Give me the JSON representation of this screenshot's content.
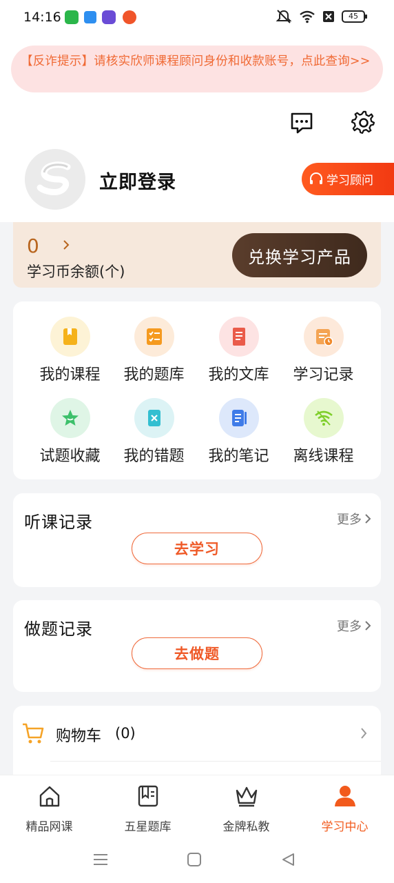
{
  "status_bar": {
    "time": "14:16",
    "battery": "45",
    "apps": [
      {
        "icon": "green-app-icon",
        "color": "#2bb64a"
      },
      {
        "icon": "blue-app-icon",
        "color": "#2e8ff0"
      },
      {
        "icon": "game-app-icon",
        "color": "#6a4cd6"
      },
      {
        "icon": "orange-app-icon",
        "color": "#f0552a"
      }
    ]
  },
  "notice": {
    "text": "【反诈提示】请核实欣师课程顾问身份和收款账号，点此查询>>"
  },
  "header_icons": {
    "message": "message-icon",
    "settings": "gear-icon"
  },
  "profile": {
    "login_label": "立即登录",
    "advisor_label": "学习顾问"
  },
  "coins": {
    "value": "0",
    "label": "学习币余额(个)",
    "exchange_label": "兑换学习产品"
  },
  "grid": {
    "items": [
      {
        "label": "我的课程",
        "icon": "course-book-icon",
        "bg": "#fdf3d6",
        "fg": "#f5b21b"
      },
      {
        "label": "我的题库",
        "icon": "question-bank-icon",
        "bg": "#fdebd9",
        "fg": "#f59a1f"
      },
      {
        "label": "我的文库",
        "icon": "library-icon",
        "bg": "#fde3e3",
        "fg": "#ea5b4a"
      },
      {
        "label": "学习记录",
        "icon": "study-record-icon",
        "bg": "#fde9da",
        "fg": "#f4a453"
      },
      {
        "label": "试题收藏",
        "icon": "star-favorite-icon",
        "bg": "#dff5e6",
        "fg": "#3dc06b"
      },
      {
        "label": "我的错题",
        "icon": "wrong-question-icon",
        "bg": "#dcf3f5",
        "fg": "#33bfd1"
      },
      {
        "label": "我的笔记",
        "icon": "notes-icon",
        "bg": "#dde8fb",
        "fg": "#3e7be8"
      },
      {
        "label": "离线课程",
        "icon": "offline-wifi-icon",
        "bg": "#e7f8cf",
        "fg": "#7fcf2b"
      }
    ]
  },
  "listen_record": {
    "title": "听课记录",
    "more": "更多",
    "button": "去学习"
  },
  "practice_record": {
    "title": "做题记录",
    "more": "更多",
    "button": "去做题"
  },
  "cart": {
    "label": "购物车",
    "count": "(0)"
  },
  "bottom_nav": {
    "items": [
      {
        "label": "精品网课",
        "icon": "home-icon"
      },
      {
        "label": "五星题库",
        "icon": "question-bank-nav-icon"
      },
      {
        "label": "金牌私教",
        "icon": "crown-icon"
      },
      {
        "label": "学习中心",
        "icon": "person-icon",
        "active": true
      }
    ]
  },
  "colors": {
    "accent": "#f25a1c",
    "coin_card": "#f6e8dc",
    "exchange_button": "#4c3324",
    "notice_bg": "#fde2e2"
  }
}
